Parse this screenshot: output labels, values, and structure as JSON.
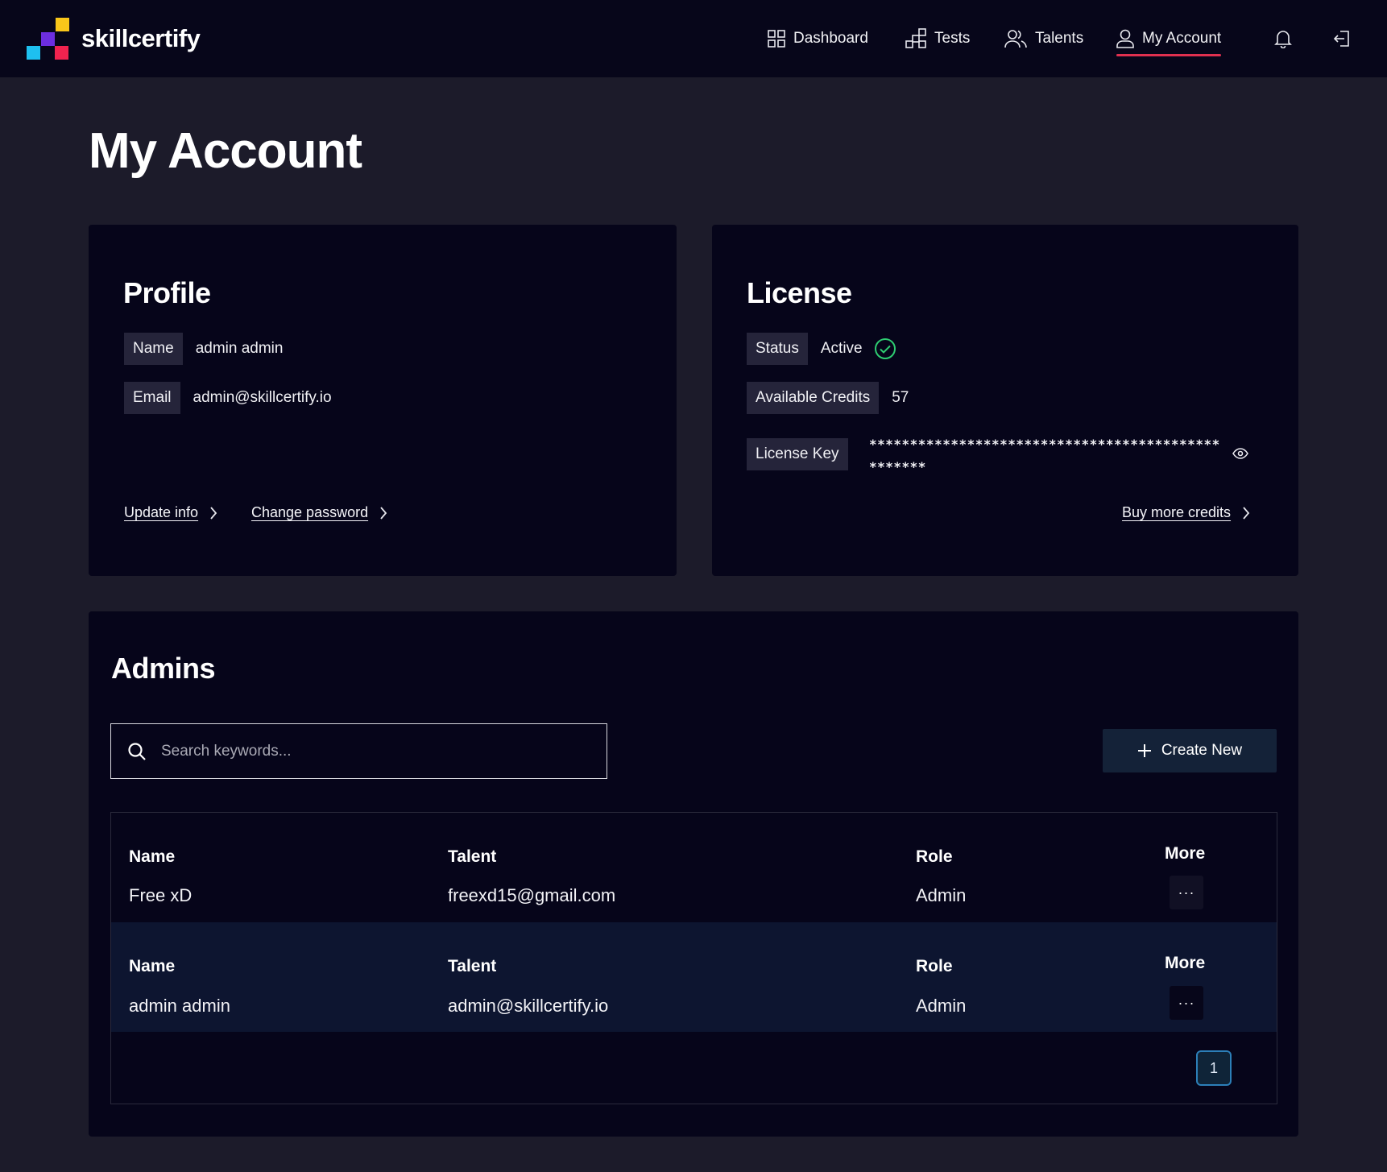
{
  "brand": {
    "name": "skillcertify"
  },
  "nav": {
    "items": [
      {
        "label": "Dashboard",
        "icon": "dashboard-grid-icon"
      },
      {
        "label": "Tests",
        "icon": "tests-blocks-icon"
      },
      {
        "label": "Talents",
        "icon": "talents-users-icon"
      },
      {
        "label": "My Account",
        "icon": "user-icon",
        "active": true
      }
    ],
    "notification_icon": "bell-icon",
    "logout_icon": "logout-icon",
    "active_color": "#e0304f"
  },
  "page": {
    "title": "My Account"
  },
  "profile": {
    "title": "Profile",
    "name_label": "Name",
    "name_value": "admin admin",
    "email_label": "Email",
    "email_value": "admin@skillcertify.io",
    "update_link": "Update info",
    "password_link": "Change password"
  },
  "license": {
    "title": "License",
    "status_label": "Status",
    "status_value": "Active",
    "status_icon": "check-circle-icon",
    "status_color": "#2ecc71",
    "credits_label": "Available Credits",
    "credits_value": "57",
    "key_label": "License Key",
    "key_value": "**************************************************",
    "reveal_icon": "eye-icon",
    "buy_link": "Buy more credits"
  },
  "admins": {
    "title": "Admins",
    "search_placeholder": "Search keywords...",
    "search_value": "",
    "create_label": "Create New",
    "columns": [
      "Name",
      "Talent",
      "Role",
      "More"
    ],
    "rows": [
      {
        "name": "Free xD",
        "talent": "freexd15@gmail.com",
        "role": "Admin",
        "more": "···"
      },
      {
        "name": "admin admin",
        "talent": "admin@skillcertify.io",
        "role": "Admin",
        "more": "···"
      }
    ],
    "pagination": {
      "current": "1"
    }
  }
}
